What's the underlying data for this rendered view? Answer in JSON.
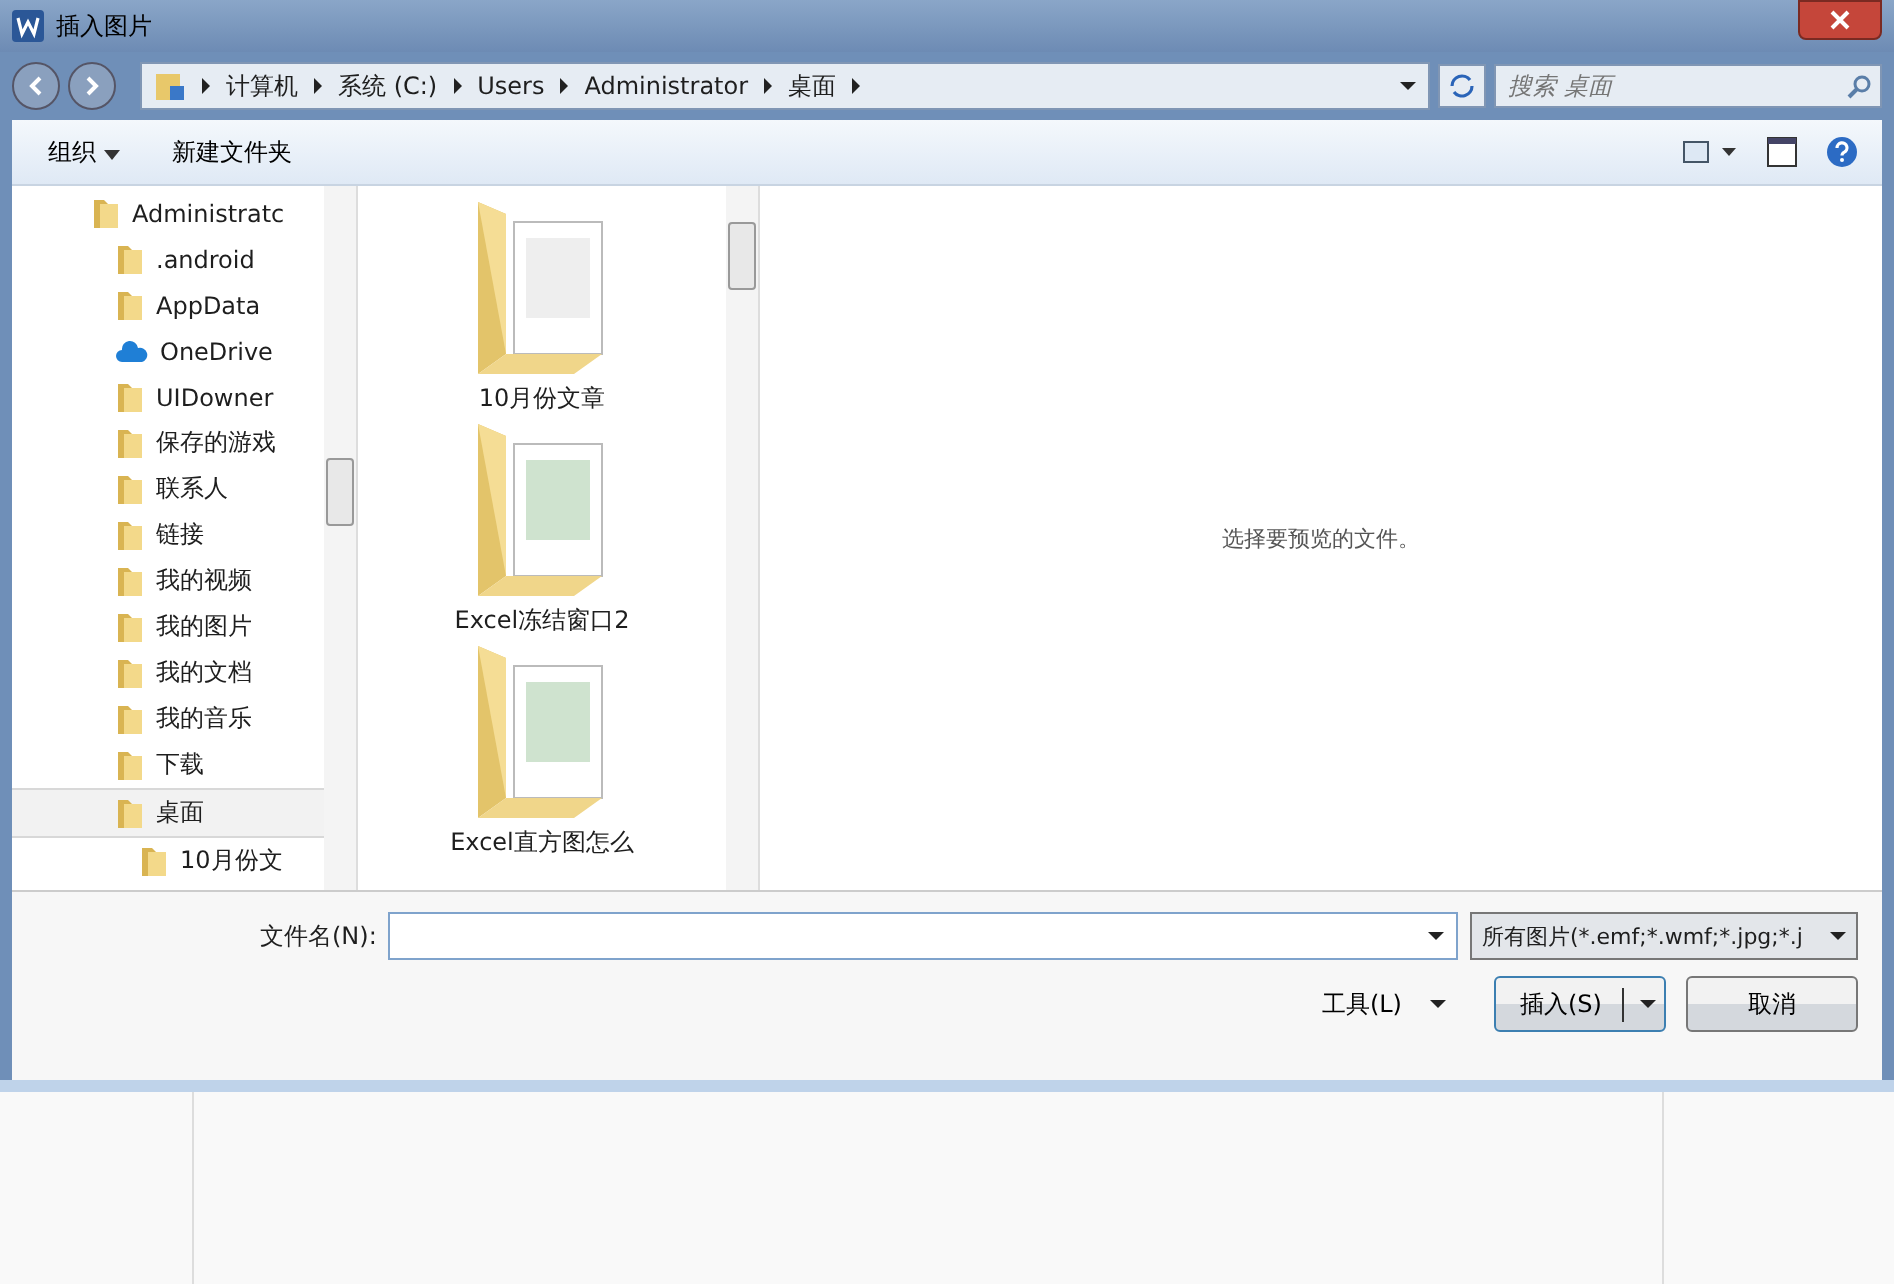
{
  "window": {
    "title": "插入图片"
  },
  "address": {
    "crumbs": [
      "计算机",
      "系统 (C:)",
      "Users",
      "Administrator",
      "桌面"
    ]
  },
  "search": {
    "placeholder": "搜索 桌面"
  },
  "toolbar": {
    "organize": "组织",
    "new_folder": "新建文件夹"
  },
  "tree": [
    {
      "label": "Administratc",
      "kind": "folder",
      "selected": false,
      "children": [
        {
          "label": ".android",
          "kind": "folder",
          "selected": false
        },
        {
          "label": "AppData",
          "kind": "folder",
          "selected": false
        },
        {
          "label": "OneDrive",
          "kind": "cloud",
          "selected": false
        },
        {
          "label": "UIDowner",
          "kind": "folder",
          "selected": false
        },
        {
          "label": "保存的游戏",
          "kind": "folder",
          "selected": false
        },
        {
          "label": "联系人",
          "kind": "folder",
          "selected": false
        },
        {
          "label": "链接",
          "kind": "folder",
          "selected": false
        },
        {
          "label": "我的视频",
          "kind": "folder",
          "selected": false
        },
        {
          "label": "我的图片",
          "kind": "folder",
          "selected": false
        },
        {
          "label": "我的文档",
          "kind": "folder",
          "selected": false
        },
        {
          "label": "我的音乐",
          "kind": "folder",
          "selected": false
        },
        {
          "label": "下载",
          "kind": "folder",
          "selected": false
        },
        {
          "label": "桌面",
          "kind": "folder",
          "selected": true,
          "children": [
            {
              "label": "10月份文",
              "kind": "folder",
              "selected": false
            }
          ]
        }
      ]
    }
  ],
  "files": [
    {
      "name": "10月份文章"
    },
    {
      "name": "Excel冻结窗口2"
    },
    {
      "name": "Excel直方图怎么"
    }
  ],
  "preview": {
    "message": "选择要预览的文件。"
  },
  "filename": {
    "label": "文件名(N):"
  },
  "filter": {
    "value": "所有图片(*.emf;*.wmf;*.jpg;*.j"
  },
  "buttons": {
    "tools": "工具(L)",
    "insert": "插入(S)",
    "cancel": "取消"
  }
}
